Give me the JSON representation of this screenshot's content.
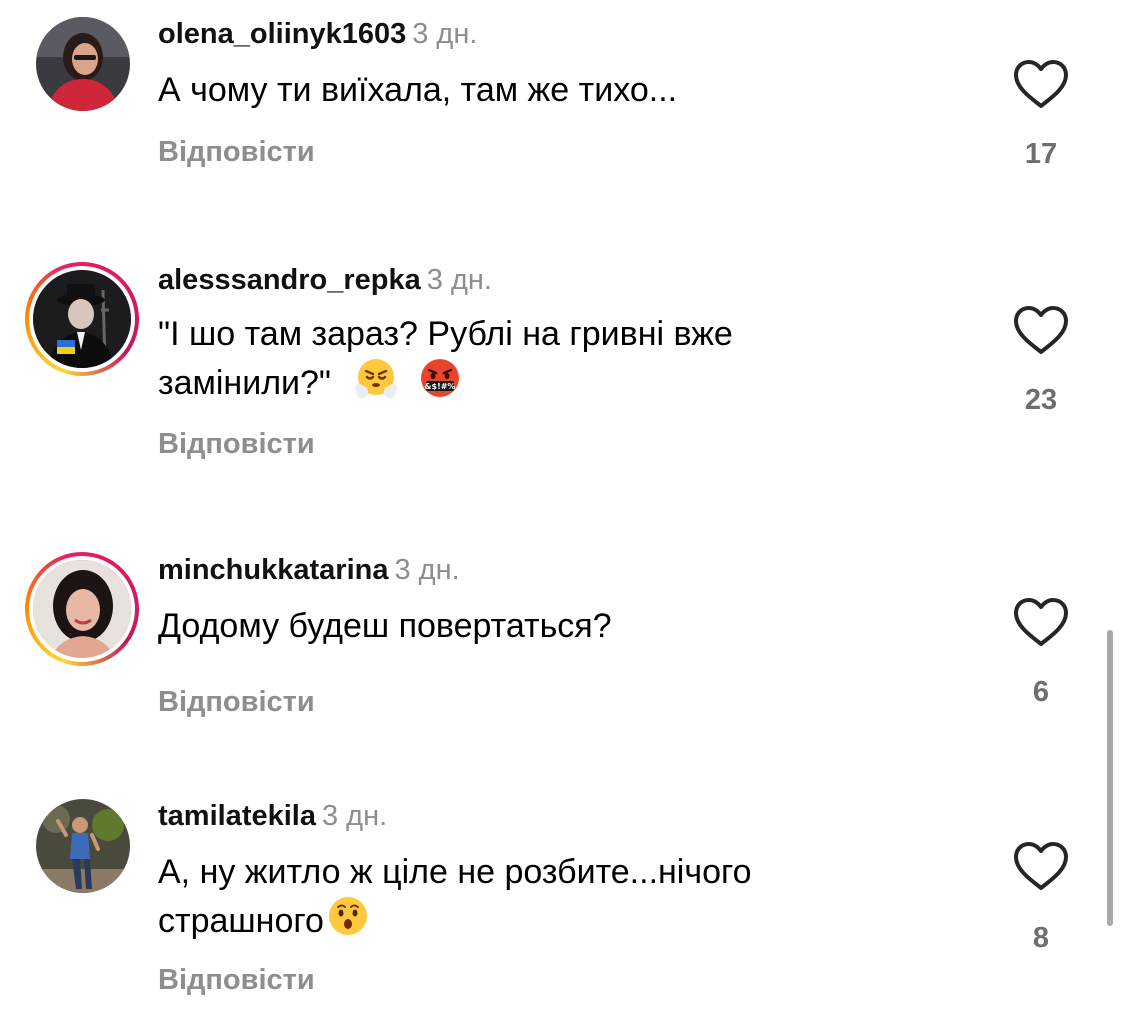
{
  "reply_label": "Відповісти",
  "comments": [
    {
      "username": "olena_oliinyk1603",
      "time": "3 дн.",
      "text": "А чому ти виїхала, там же тихо...",
      "likes": "17",
      "story_ring": false
    },
    {
      "username": "alesssandro_repka",
      "time": "3 дн.",
      "text": "\"І шо там зараз? Рублі на гривні вже замінили?\"",
      "emojis": [
        "face-with-steam-icon",
        "face-with-symbols-on-mouth-icon"
      ],
      "likes": "23",
      "story_ring": true
    },
    {
      "username": "minchukkatarina",
      "time": "3 дн.",
      "text": "Додому будеш повертаться?",
      "likes": "6",
      "story_ring": true
    },
    {
      "username": "tamilatekila",
      "time": "3 дн.",
      "text": "А, ну житло ж ціле не розбите...нічого страшного",
      "emojis": [
        "hushed-face-icon"
      ],
      "likes": "8",
      "story_ring": false
    }
  ],
  "colors": {
    "text": "#000000",
    "secondary": "#8e8e8e",
    "ring_start": "#fdd835",
    "ring_end": "#d81b60"
  }
}
